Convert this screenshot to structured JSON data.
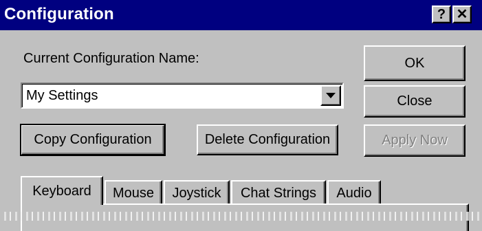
{
  "window": {
    "title": "Configuration",
    "help_glyph": "?",
    "close_glyph": "✕"
  },
  "config": {
    "name_label": "Current Configuration Name:",
    "selected_value": "My Settings"
  },
  "buttons": {
    "ok": "OK",
    "close": "Close",
    "apply": "Apply Now",
    "copy": "Copy Configuration",
    "delete": "Delete Configuration"
  },
  "tabs": [
    {
      "label": "Keyboard",
      "active": true
    },
    {
      "label": "Mouse",
      "active": false
    },
    {
      "label": "Joystick",
      "active": false
    },
    {
      "label": "Chat Strings",
      "active": false
    },
    {
      "label": "Audio",
      "active": false
    }
  ],
  "colors": {
    "titlebar": "#000080",
    "face": "#c0c0c0",
    "disabled_text": "#808080"
  }
}
